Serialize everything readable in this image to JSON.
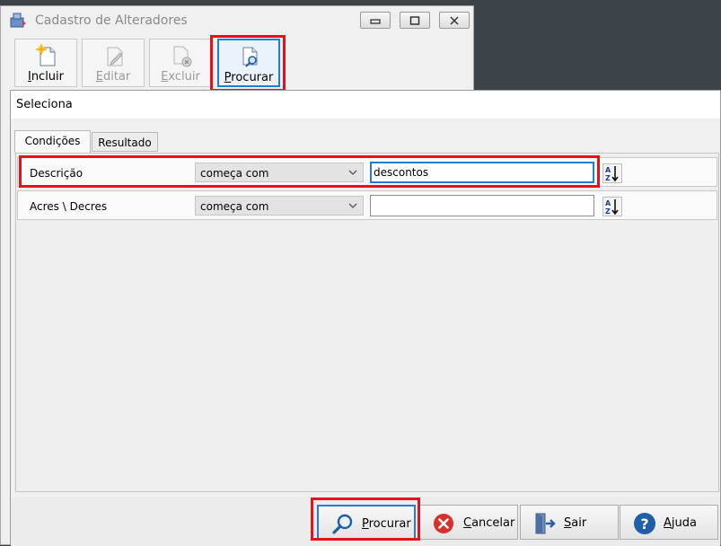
{
  "background_window": {
    "title": "Cadastro de Alteradores",
    "toolbar": [
      {
        "mnemonic": "I",
        "rest": "ncluir",
        "disabled": false
      },
      {
        "mnemonic": "E",
        "rest": "ditar",
        "disabled": true
      },
      {
        "mnemonic": "E",
        "rest": "xcluir",
        "disabled": true
      },
      {
        "mnemonic": "P",
        "rest": "rocurar",
        "disabled": false
      }
    ]
  },
  "dialog": {
    "title": "Seleciona",
    "tabs": [
      "Condições",
      "Resultado"
    ],
    "conditions": [
      {
        "label": "Descrição",
        "operator": "começa com",
        "value": "descontos"
      },
      {
        "label": "Acres \\ Decres",
        "operator": "começa com",
        "value": ""
      }
    ],
    "buttons": [
      {
        "mnemonic": "P",
        "rest": "rocurar"
      },
      {
        "mnemonic": "C",
        "rest": "ancelar"
      },
      {
        "mnemonic": "S",
        "rest": "air"
      },
      {
        "mnemonic": "A",
        "rest": "juda"
      }
    ]
  },
  "colors": {
    "highlight": "#e8101a",
    "focus": "#1e7fd6",
    "cancel_icon": "#d9302c",
    "help_icon": "#1f5fa8"
  }
}
